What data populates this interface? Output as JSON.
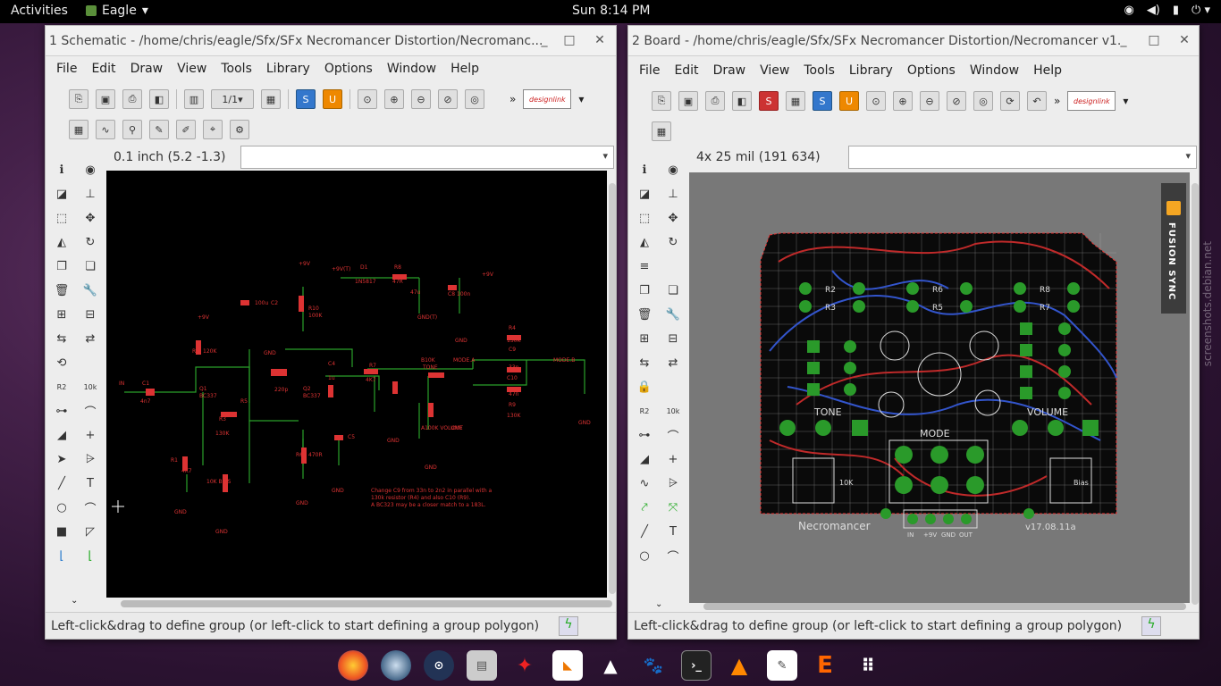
{
  "topbar": {
    "activities": "Activities",
    "app": "Eagle",
    "clock": "Sun  8:14 PM",
    "icons": [
      "wifi-icon",
      "volume-icon",
      "battery-icon",
      "power-icon"
    ]
  },
  "schematic": {
    "title": "1 Schematic - /home/chris/eagle/Sfx/SFx Necromancer Distortion/Necromanc...",
    "menu": [
      "File",
      "Edit",
      "Draw",
      "View",
      "Tools",
      "Library",
      "Options",
      "Window",
      "Help"
    ],
    "sheet": "1/1",
    "coord": "0.1 inch (5.2 -1.3)",
    "command": "",
    "status": "Left-click&drag to define group (or left-click to start defining a group polygon)",
    "labels": {
      "vplus1": "+9V",
      "vplus2": "+9V",
      "vplus3": "+9V(T)",
      "vplus4": "+9V",
      "d1": "D1",
      "d1v": "1N5817",
      "r8": "R8",
      "r8v": "47R",
      "c7": "47u",
      "c8": "C8",
      "c8v": "100n",
      "gndt": "GND(T)",
      "r10": "R10",
      "r10v": "100K",
      "c2": "C2",
      "c2v": "100u",
      "r2": "R2",
      "r2v": "120K",
      "c3": "C3",
      "c3v": "220p",
      "c4": "C4",
      "c4v": "1u",
      "r7": "R7",
      "r7v": "4K7",
      "b10k": "B10K",
      "tone": "TONE",
      "modea": "MODE.A",
      "modeb": "MODE.B",
      "r4": "R4",
      "r4v": "130K",
      "c9": "C9",
      "c9v": "33n",
      "c10": "C10",
      "c10v": "47n",
      "r9": "R9",
      "r9v": "130K",
      "in": "IN",
      "c1": "C1",
      "c1v": "4n7",
      "q1": "Q1",
      "q1v": "BC337",
      "q2": "Q2",
      "q2v": "BC337",
      "r5": "R5",
      "r3": "R3",
      "r3v": "130K",
      "r6": "R6",
      "r6v": "470R",
      "c5": "C5",
      "r1": "R1",
      "r1v": "4K7",
      "gnd": "GND",
      "out": "OUT",
      "vol": "A100K VOLUME",
      "bias": "10K BIAS",
      "note1": "Change C9 from 33n to 2n2 in parallel with a",
      "note2": "130k resistor (R4) and also C10 (R9).",
      "note3": "A BC323 may be a closer match to a 183L."
    }
  },
  "board": {
    "title": "2 Board - /home/chris/eagle/Sfx/SFx Necromancer Distortion/Necromancer v1...",
    "menu": [
      "File",
      "Edit",
      "Draw",
      "View",
      "Tools",
      "Library",
      "Options",
      "Window",
      "Help"
    ],
    "coord": "4x 25 mil (191 634)",
    "command": "",
    "status": "Left-click&drag to define group (or left-click to start defining a group polygon)",
    "labels": {
      "tone": "TONE",
      "volume": "VOLUME",
      "mode": "MODE",
      "brand": "Necromancer",
      "version": "v17.08.11a",
      "r2": "R2",
      "r3": "R3",
      "r6": "R6",
      "r5": "R5",
      "r8": "R8",
      "r7": "R7",
      "in": "IN",
      "p9v": "+9V",
      "gnd": "GND",
      "out": "OUT",
      "bias": "Bias",
      "r1k": "10K"
    }
  },
  "fusion": "FUSION SYNC",
  "watermark": "screenshots.debian.net",
  "design_link": "designlink",
  "dock": [
    "firefox-icon",
    "thunderbird-icon",
    "keepassx-icon",
    "files-icon",
    "red-bird-icon",
    "slides-icon",
    "inkscape-icon",
    "gimp-icon",
    "terminal-icon",
    "vlc-icon",
    "notes-icon",
    "eagle-icon",
    "apps-grid-icon"
  ]
}
